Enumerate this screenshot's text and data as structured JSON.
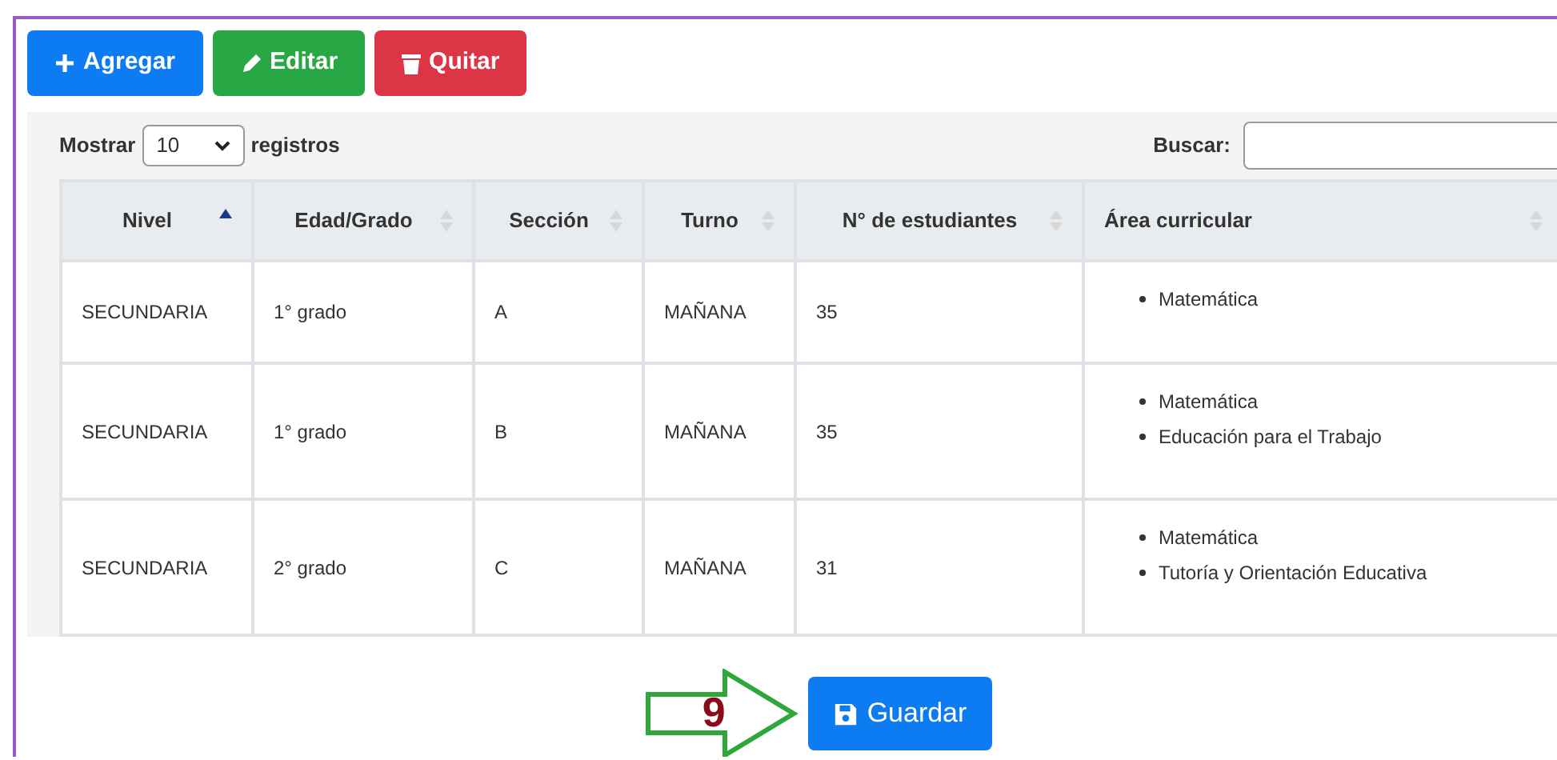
{
  "toolbar": [
    {
      "kind": "add",
      "label": "Agregar"
    },
    {
      "kind": "edit",
      "label": "Editar"
    },
    {
      "kind": "delete",
      "label": "Quitar"
    }
  ],
  "length_control": {
    "label_before": "Mostrar",
    "value": "10",
    "label_after": "registros"
  },
  "search": {
    "label": "Buscar:"
  },
  "table": {
    "columns": [
      {
        "label": "Nivel",
        "sorted": true
      },
      {
        "label": "Edad/Grado",
        "sorted": false
      },
      {
        "label": "Sección",
        "sorted": false
      },
      {
        "label": "Turno",
        "sorted": false
      },
      {
        "label": "N° de estudiantes",
        "sorted": false
      },
      {
        "label": "Área curricular",
        "sorted": false
      }
    ],
    "rows": [
      {
        "cells": [
          "SECUNDARIA",
          "1° grado",
          "A",
          "MAÑANA",
          "35"
        ],
        "areas": [
          "Matemática"
        ]
      },
      {
        "cells": [
          "SECUNDARIA",
          "1° grado",
          "B",
          "MAÑANA",
          "35"
        ],
        "areas": [
          "Matemática",
          "Educación para el Trabajo"
        ]
      },
      {
        "cells": [
          "SECUNDARIA",
          "2° grado",
          "C",
          "MAÑANA",
          "31"
        ],
        "areas": [
          "Matemática",
          "Tutoría y Orientación Educativa"
        ]
      }
    ]
  },
  "step_marker": "9",
  "save_button": {
    "label": "Guardar"
  }
}
